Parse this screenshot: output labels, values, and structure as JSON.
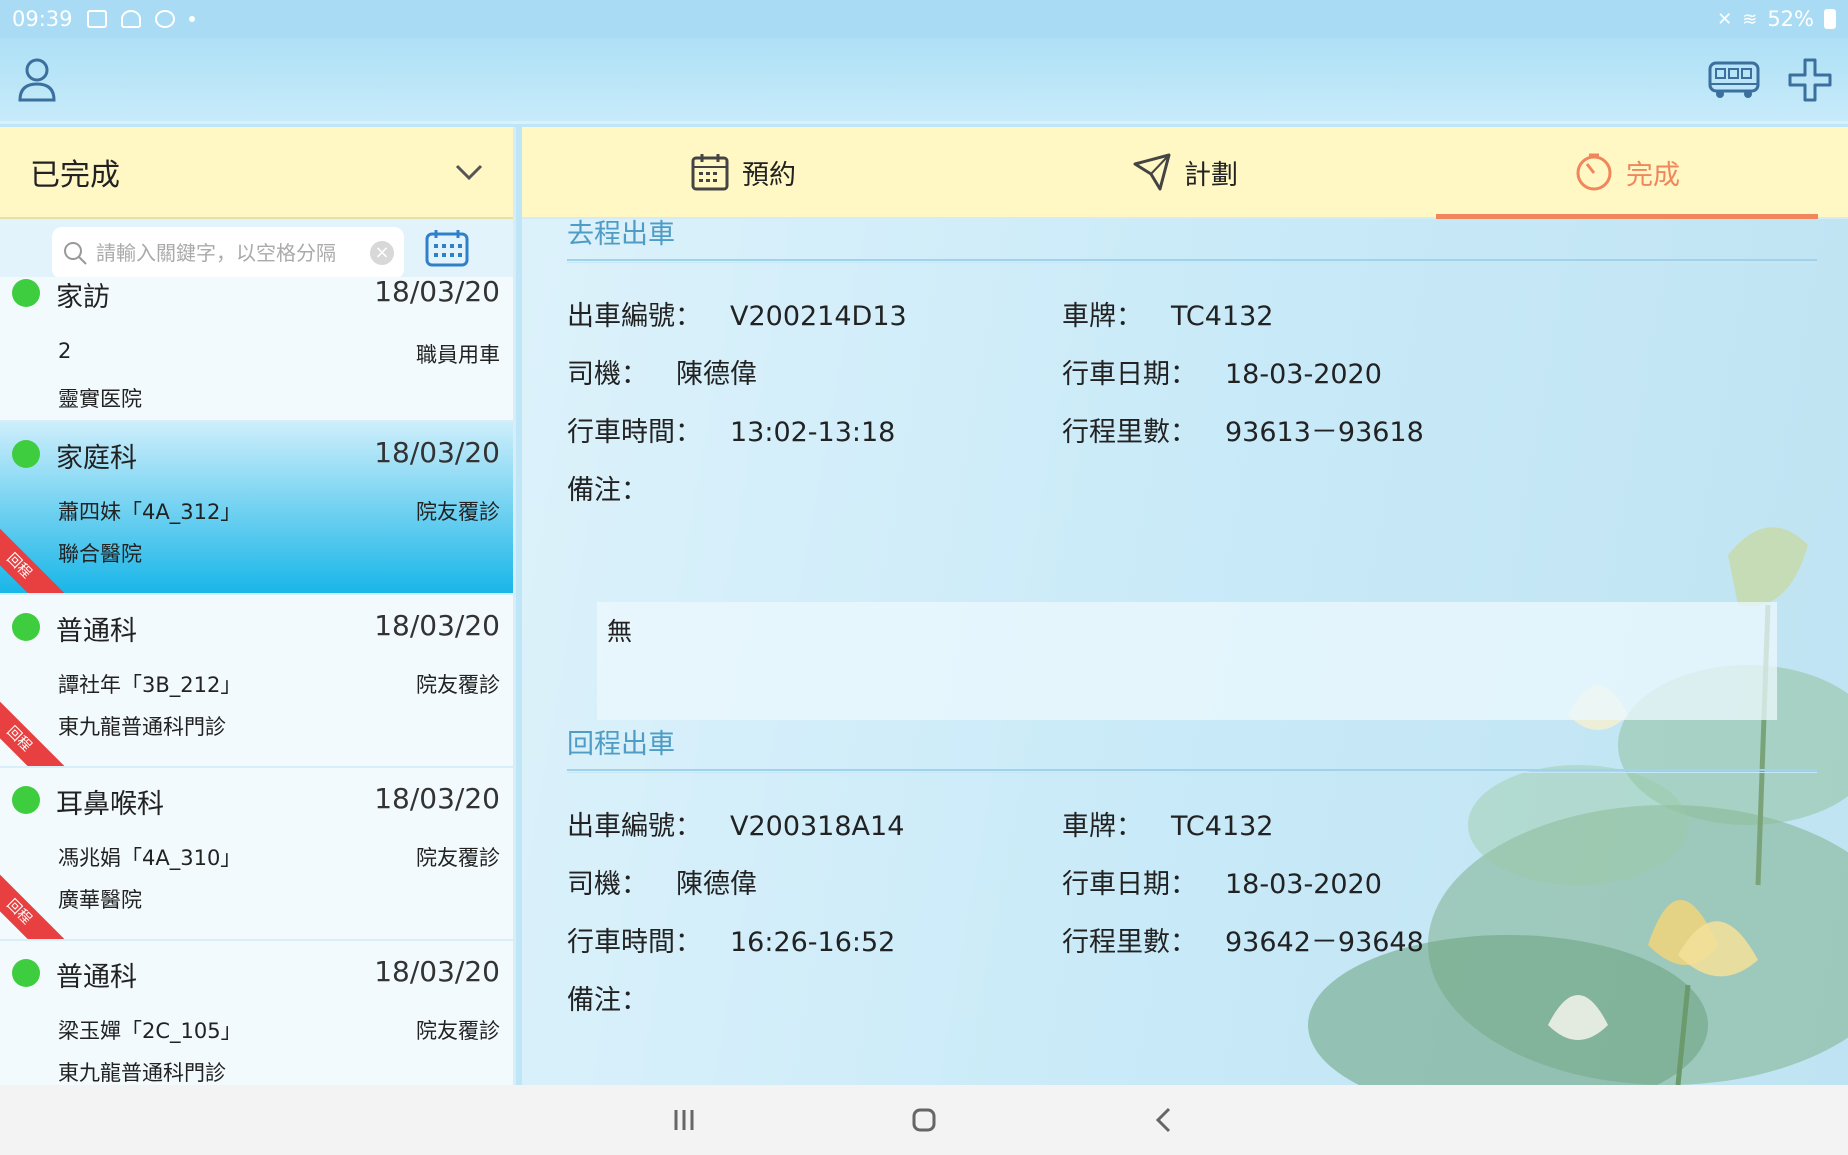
{
  "status_bar": {
    "time": "09:39",
    "battery": "52%"
  },
  "appbar": {
    "user_icon": "user-icon",
    "bus_icon": "bus-icon",
    "add_icon": "plus-icon"
  },
  "left_panel": {
    "status_filter": "已完成",
    "search_placeholder": "請輸入關鍵字，以空格分隔",
    "cards": [
      {
        "dept": "家訪",
        "date": "18/03/20",
        "patient": "2",
        "type": "職員用車",
        "hospital": "靈實医院",
        "return_tag": ""
      },
      {
        "dept": "家庭科",
        "date": "18/03/20",
        "patient": "蕭四妹「4A_312」",
        "type": "院友覆診",
        "hospital": "聯合醫院",
        "return_tag": "回程"
      },
      {
        "dept": "普通科",
        "date": "18/03/20",
        "patient": "譚社年「3B_212」",
        "type": "院友覆診",
        "hospital": "東九龍普通科門診",
        "return_tag": "回程"
      },
      {
        "dept": "耳鼻喉科",
        "date": "18/03/20",
        "patient": "馮兆娟「4A_310」",
        "type": "院友覆診",
        "hospital": "廣華醫院",
        "return_tag": "回程"
      },
      {
        "dept": "普通科",
        "date": "18/03/20",
        "patient": "梁玉嬋「2C_105」",
        "type": "院友覆診",
        "hospital": "東九龍普通科門診",
        "return_tag": ""
      }
    ]
  },
  "tabs": [
    {
      "label": "預約"
    },
    {
      "label": "計劃"
    },
    {
      "label": "完成"
    }
  ],
  "outbound": {
    "title": "去程出車",
    "trip_no_label": "出車編號：",
    "trip_no": "V200214D13",
    "plate_label": "車牌：",
    "plate": "TC4132",
    "driver_label": "司機：",
    "driver": "陳德偉",
    "date_label": "行車日期：",
    "date": "18-03-2020",
    "time_label": "行車時間：",
    "time": "13:02-13:18",
    "mileage_label": "行程里數：",
    "mileage": "93613－93618",
    "remark_label": "備注：",
    "remark": "無"
  },
  "inbound": {
    "title": "回程出車",
    "trip_no_label": "出車編號：",
    "trip_no": "V200318A14",
    "plate_label": "車牌：",
    "plate": "TC4132",
    "driver_label": "司機：",
    "driver": "陳德偉",
    "date_label": "行車日期：",
    "date": "18-03-2020",
    "time_label": "行車時間：",
    "time": "16:26-16:52",
    "mileage_label": "行程里數：",
    "mileage": "93642－93648",
    "remark_label": "備注："
  },
  "colors": {
    "accent": "#f0875c",
    "section_title": "#4f9cc4",
    "tab_bg": "#fff8c5",
    "active_card": "#19b6e8",
    "status_dot": "#3ecd3e",
    "return_tag": "#e84040"
  }
}
